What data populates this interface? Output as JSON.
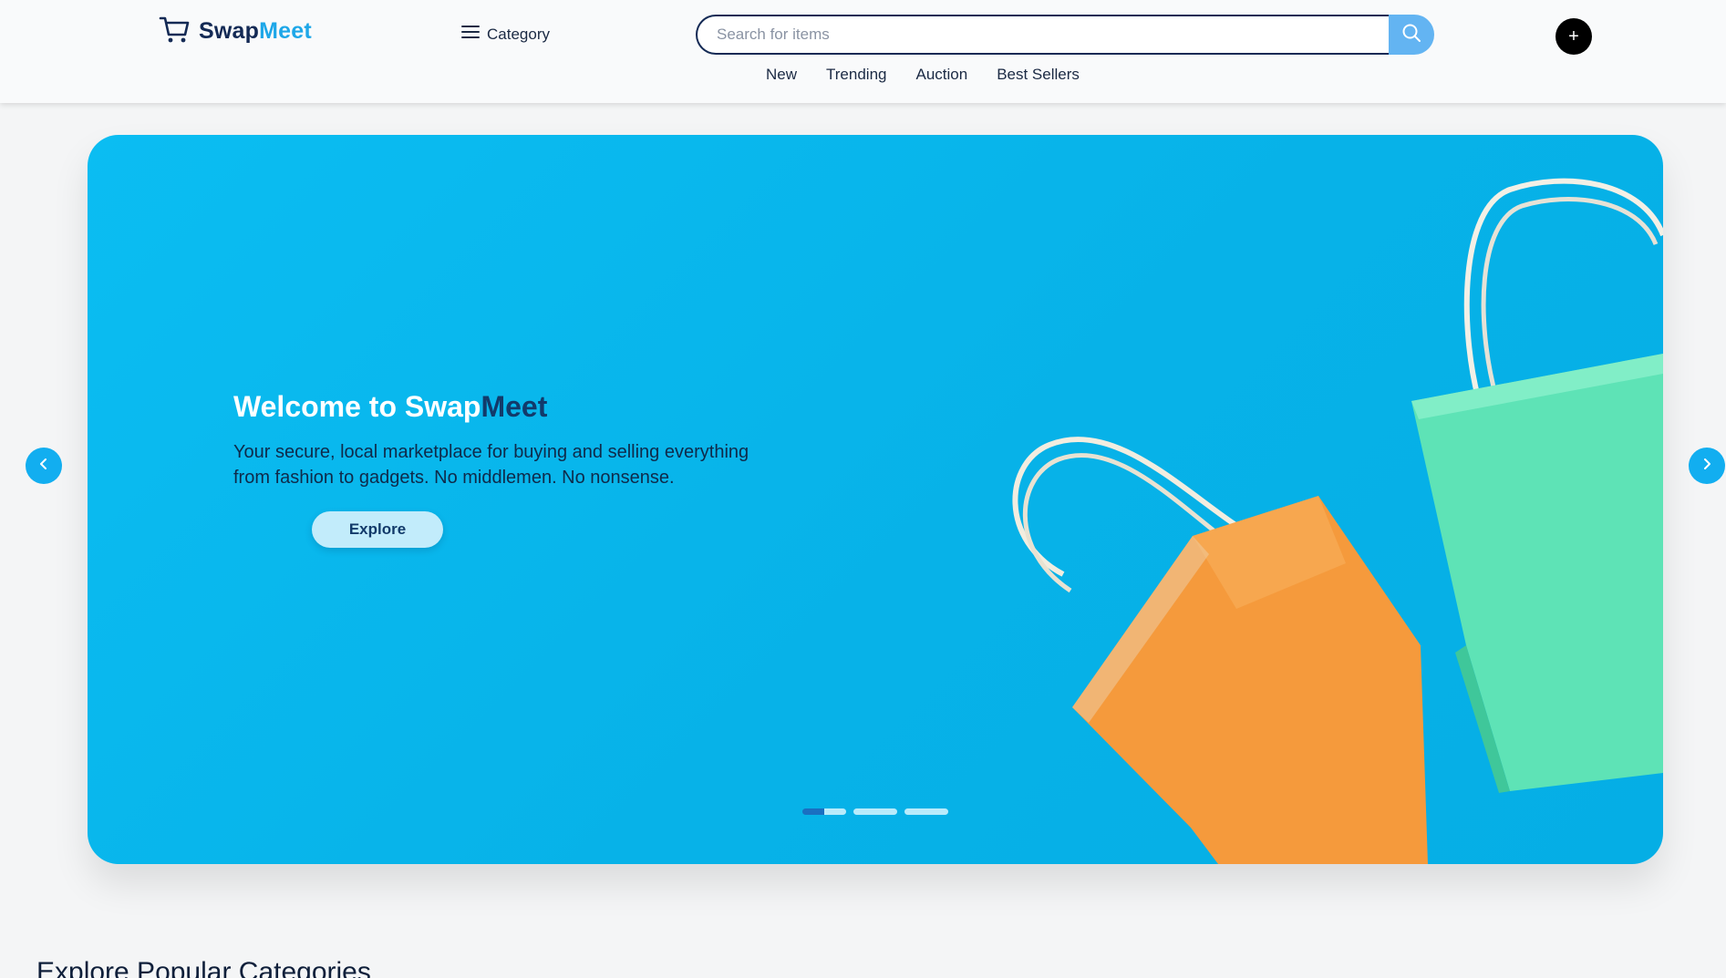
{
  "header": {
    "logo": {
      "swap": "Swap",
      "meet": "Meet",
      "icon": "cart-icon"
    },
    "category_label": "Category",
    "search": {
      "placeholder": "Search for items",
      "value": ""
    },
    "add_label": "+",
    "nav": [
      "New",
      "Trending",
      "Auction",
      "Best Sellers"
    ]
  },
  "hero": {
    "title_prefix": "Welcome to Swap",
    "title_accent": "Meet",
    "subtitle_line1": "Your secure, local marketplace for buying and selling everything",
    "subtitle_line2": "from fashion to gadgets. No middlemen. No nonsense.",
    "cta_label": "Explore",
    "slide_count": 3,
    "active_slide": 1
  },
  "section": {
    "title": "Explore Popular Categories"
  },
  "colors": {
    "brand_navy": "#142a55",
    "brand_blue": "#1ea7e8",
    "hero_bg": "#0bbdf2",
    "bag_orange": "#f59a3c",
    "bag_mint": "#5ee3b6"
  }
}
